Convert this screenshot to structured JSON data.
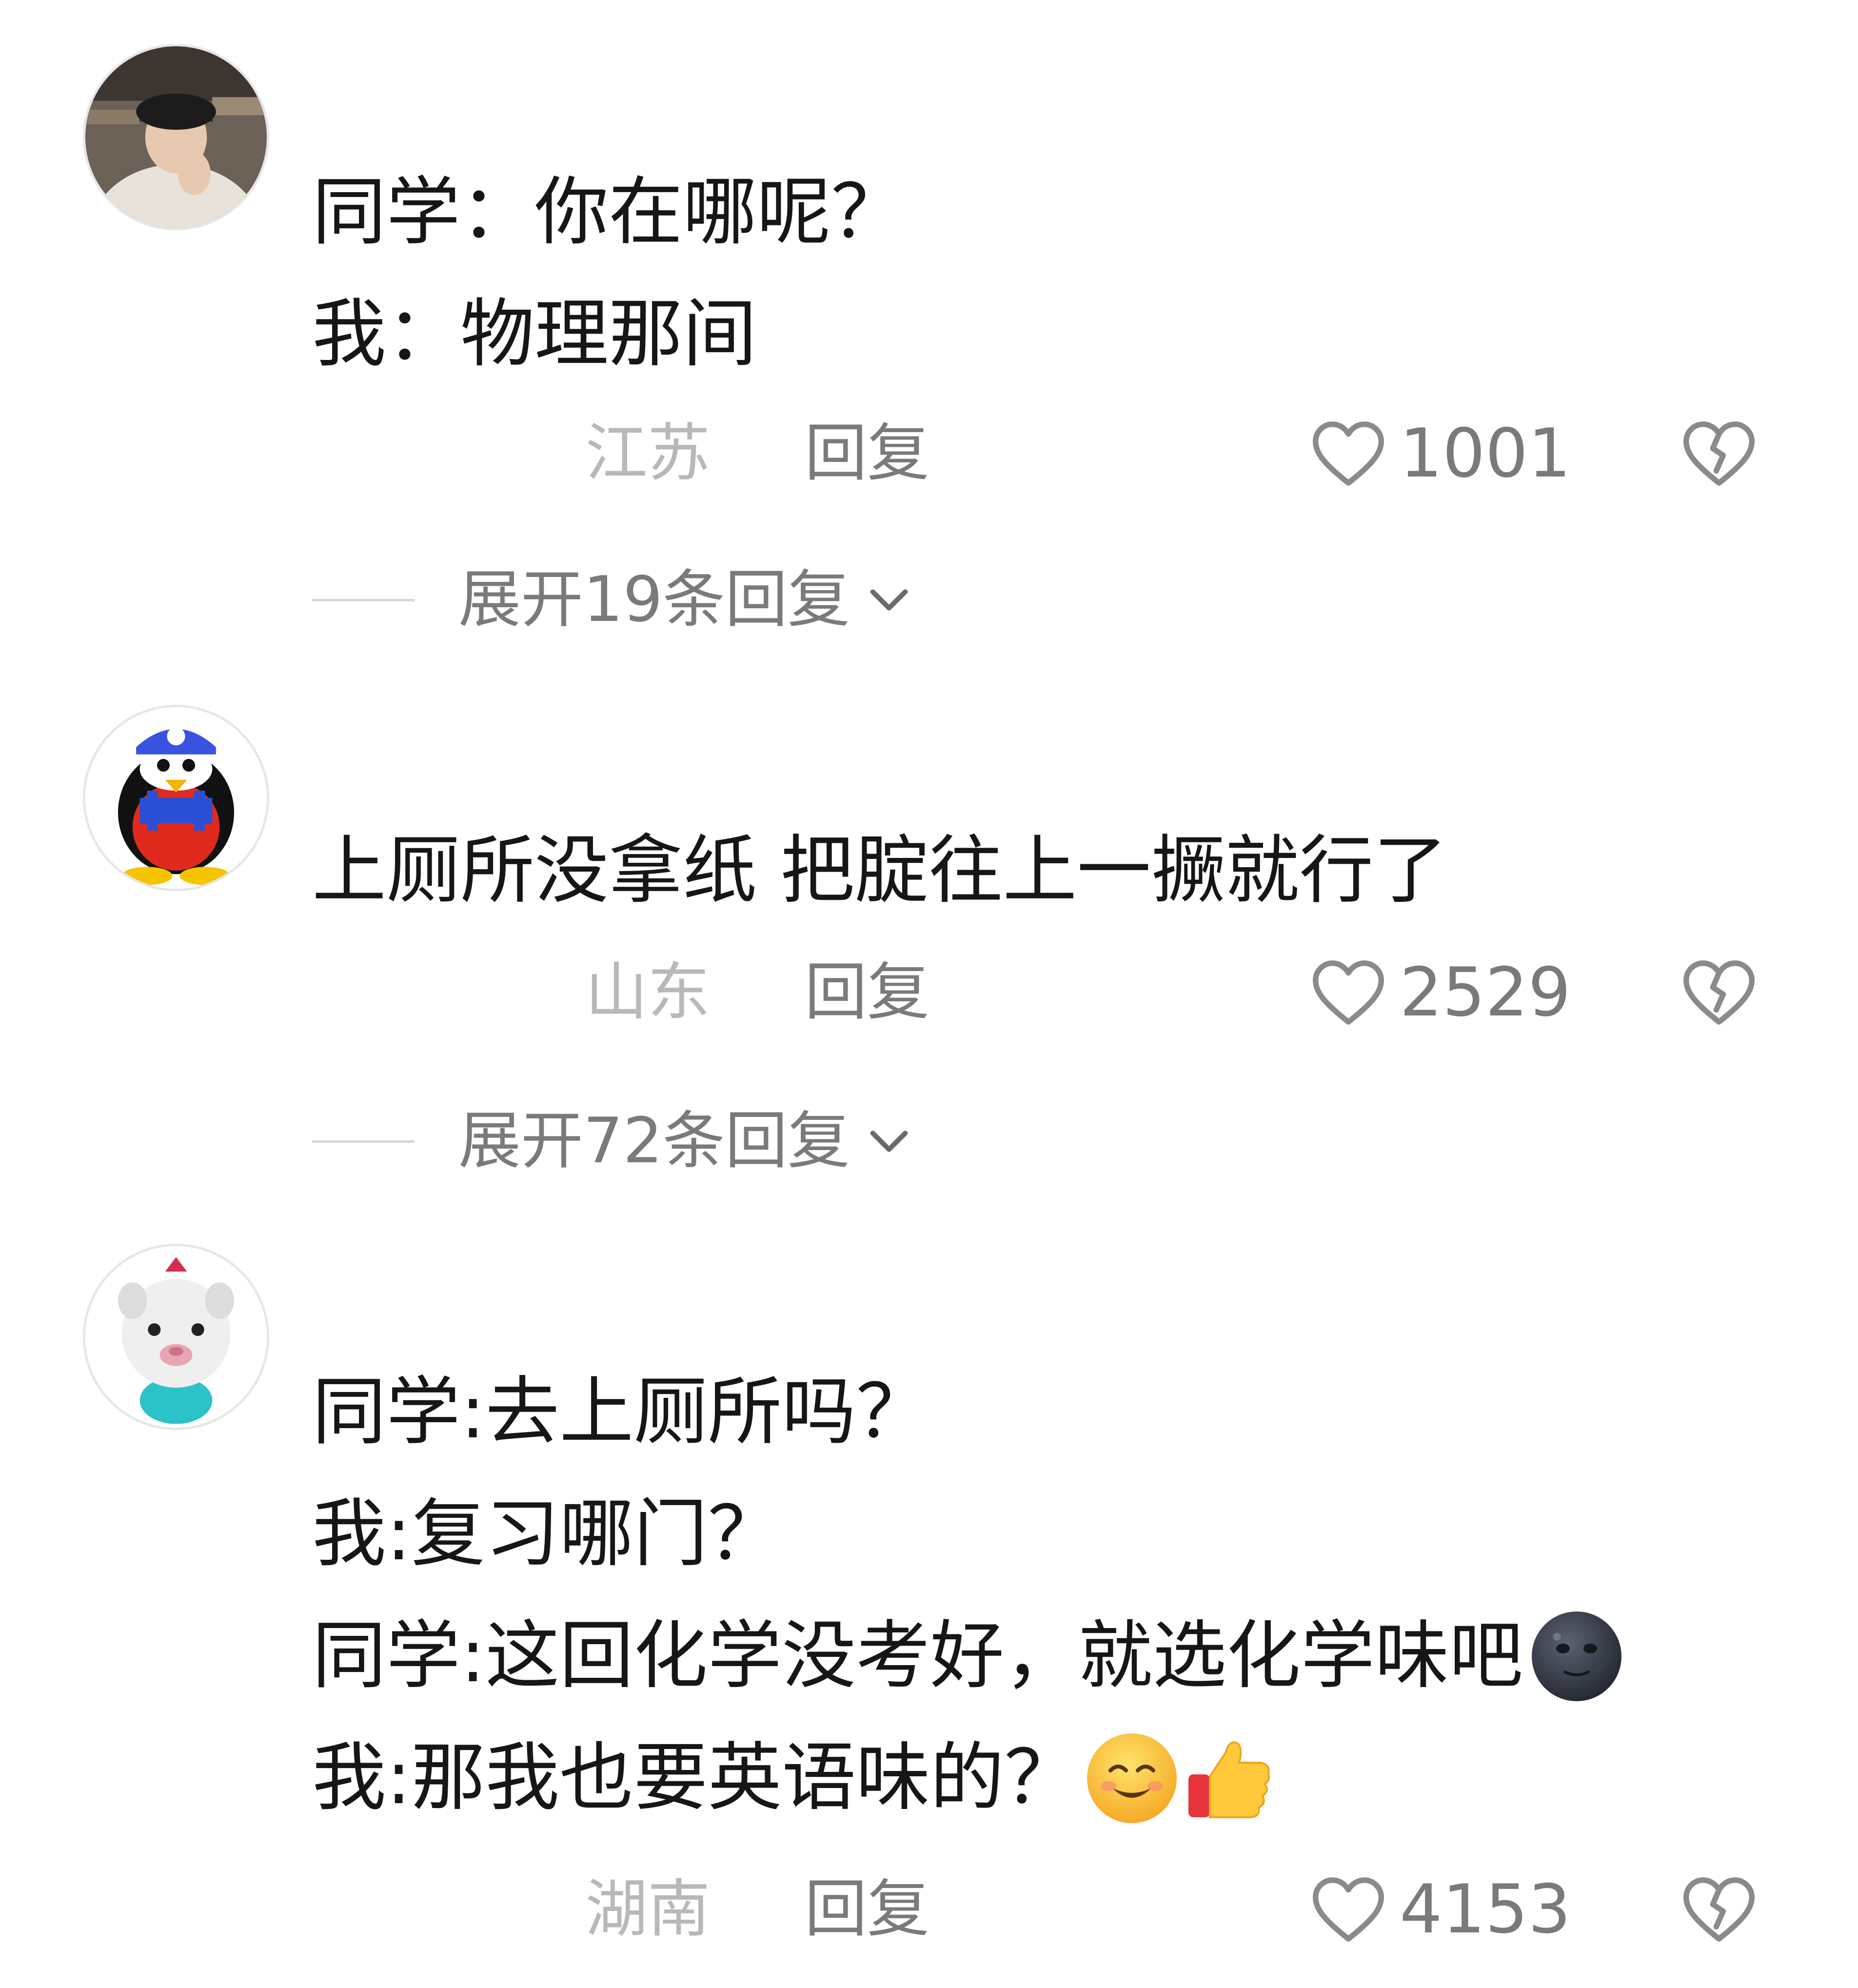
{
  "comments": [
    {
      "lines": [
        "同学：你在哪呢？",
        "我：物理那间"
      ],
      "location": "江苏",
      "reply_label": "回复",
      "likes": "1001",
      "expand_label": "展开19条回复"
    },
    {
      "lines": [
        "上厕所没拿纸 把腚往上一撅就行了"
      ],
      "location": "山东",
      "reply_label": "回复",
      "likes": "2529",
      "expand_label": "展开72条回复"
    },
    {
      "lines": [
        "同学:去上厕所吗？",
        "我:复习哪门？",
        "同学:这回化学没考好，就选化学味吧",
        "我:那我也要英语味的？"
      ],
      "location": "湖南",
      "reply_label": "回复",
      "likes": "4153"
    }
  ],
  "icons": {
    "like": "heart-outline-icon",
    "dislike": "broken-heart-icon",
    "expand": "chevron-down-icon",
    "emoji_moon": "new-moon-face-emoji",
    "emoji_smile": "smiling-face-emoji",
    "emoji_thumb": "thumbs-up-emoji"
  },
  "colors": {
    "text": "#161616",
    "secondary": "#7a7a7a",
    "location": "#b8b8b8",
    "divider": "#d8d8d8"
  }
}
